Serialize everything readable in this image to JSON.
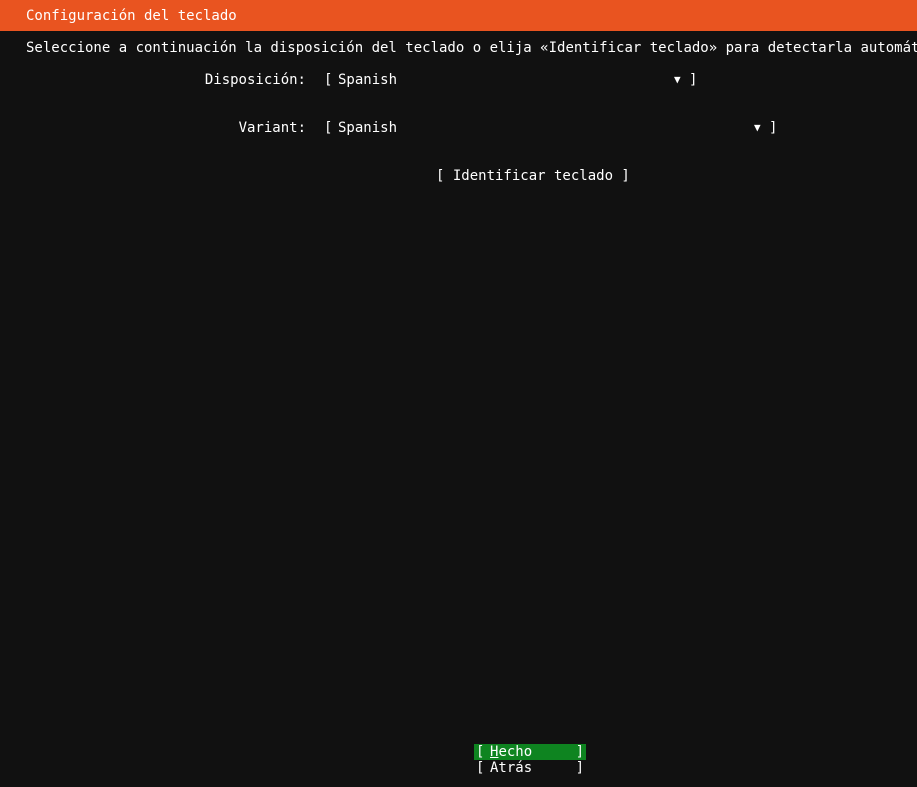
{
  "header": {
    "title": "Configuración del teclado"
  },
  "instructions": "Seleccione a continuación la disposición del teclado o elija «Identificar teclado» para detectarla automáticamente.",
  "form": {
    "layout": {
      "label": "Disposición:",
      "value": "Spanish"
    },
    "variant": {
      "label": "Variant:",
      "value": "Spanish"
    },
    "identify_button": "[ Identificar teclado ]"
  },
  "footer": {
    "done_label": "Hecho",
    "back_label": "Atrás"
  },
  "colors": {
    "header_bg": "#e95420",
    "background": "#111111",
    "active_button_bg": "#0e8420"
  }
}
